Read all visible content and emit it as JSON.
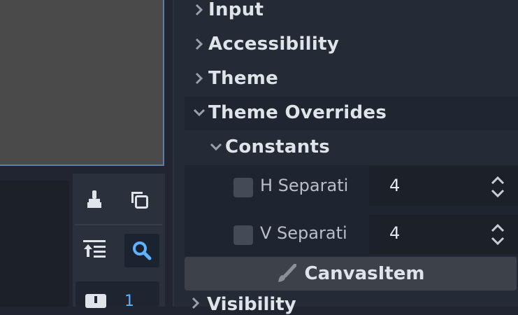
{
  "inspector": {
    "sections": [
      {
        "label": "Input",
        "expanded": false
      },
      {
        "label": "Accessibility",
        "expanded": false
      },
      {
        "label": "Theme",
        "expanded": false
      },
      {
        "label": "Theme Overrides",
        "expanded": true
      },
      {
        "label": "Constants",
        "expanded": true
      }
    ],
    "properties": [
      {
        "name": "H Separati",
        "value": "4",
        "checked": false
      },
      {
        "name": "V Separati",
        "value": "4",
        "checked": false
      }
    ],
    "canvas_item_label": "CanvasItem",
    "visibility_label": "Visibility"
  },
  "toolbar": {
    "badge_count": "1",
    "icons": [
      "clear-icon",
      "copy-icon",
      "collapse-icon",
      "search-icon"
    ]
  },
  "colors": {
    "accent": "#5fb2ff",
    "viewport": "#4a4a4a",
    "viewport_border": "#5e7ea4"
  }
}
